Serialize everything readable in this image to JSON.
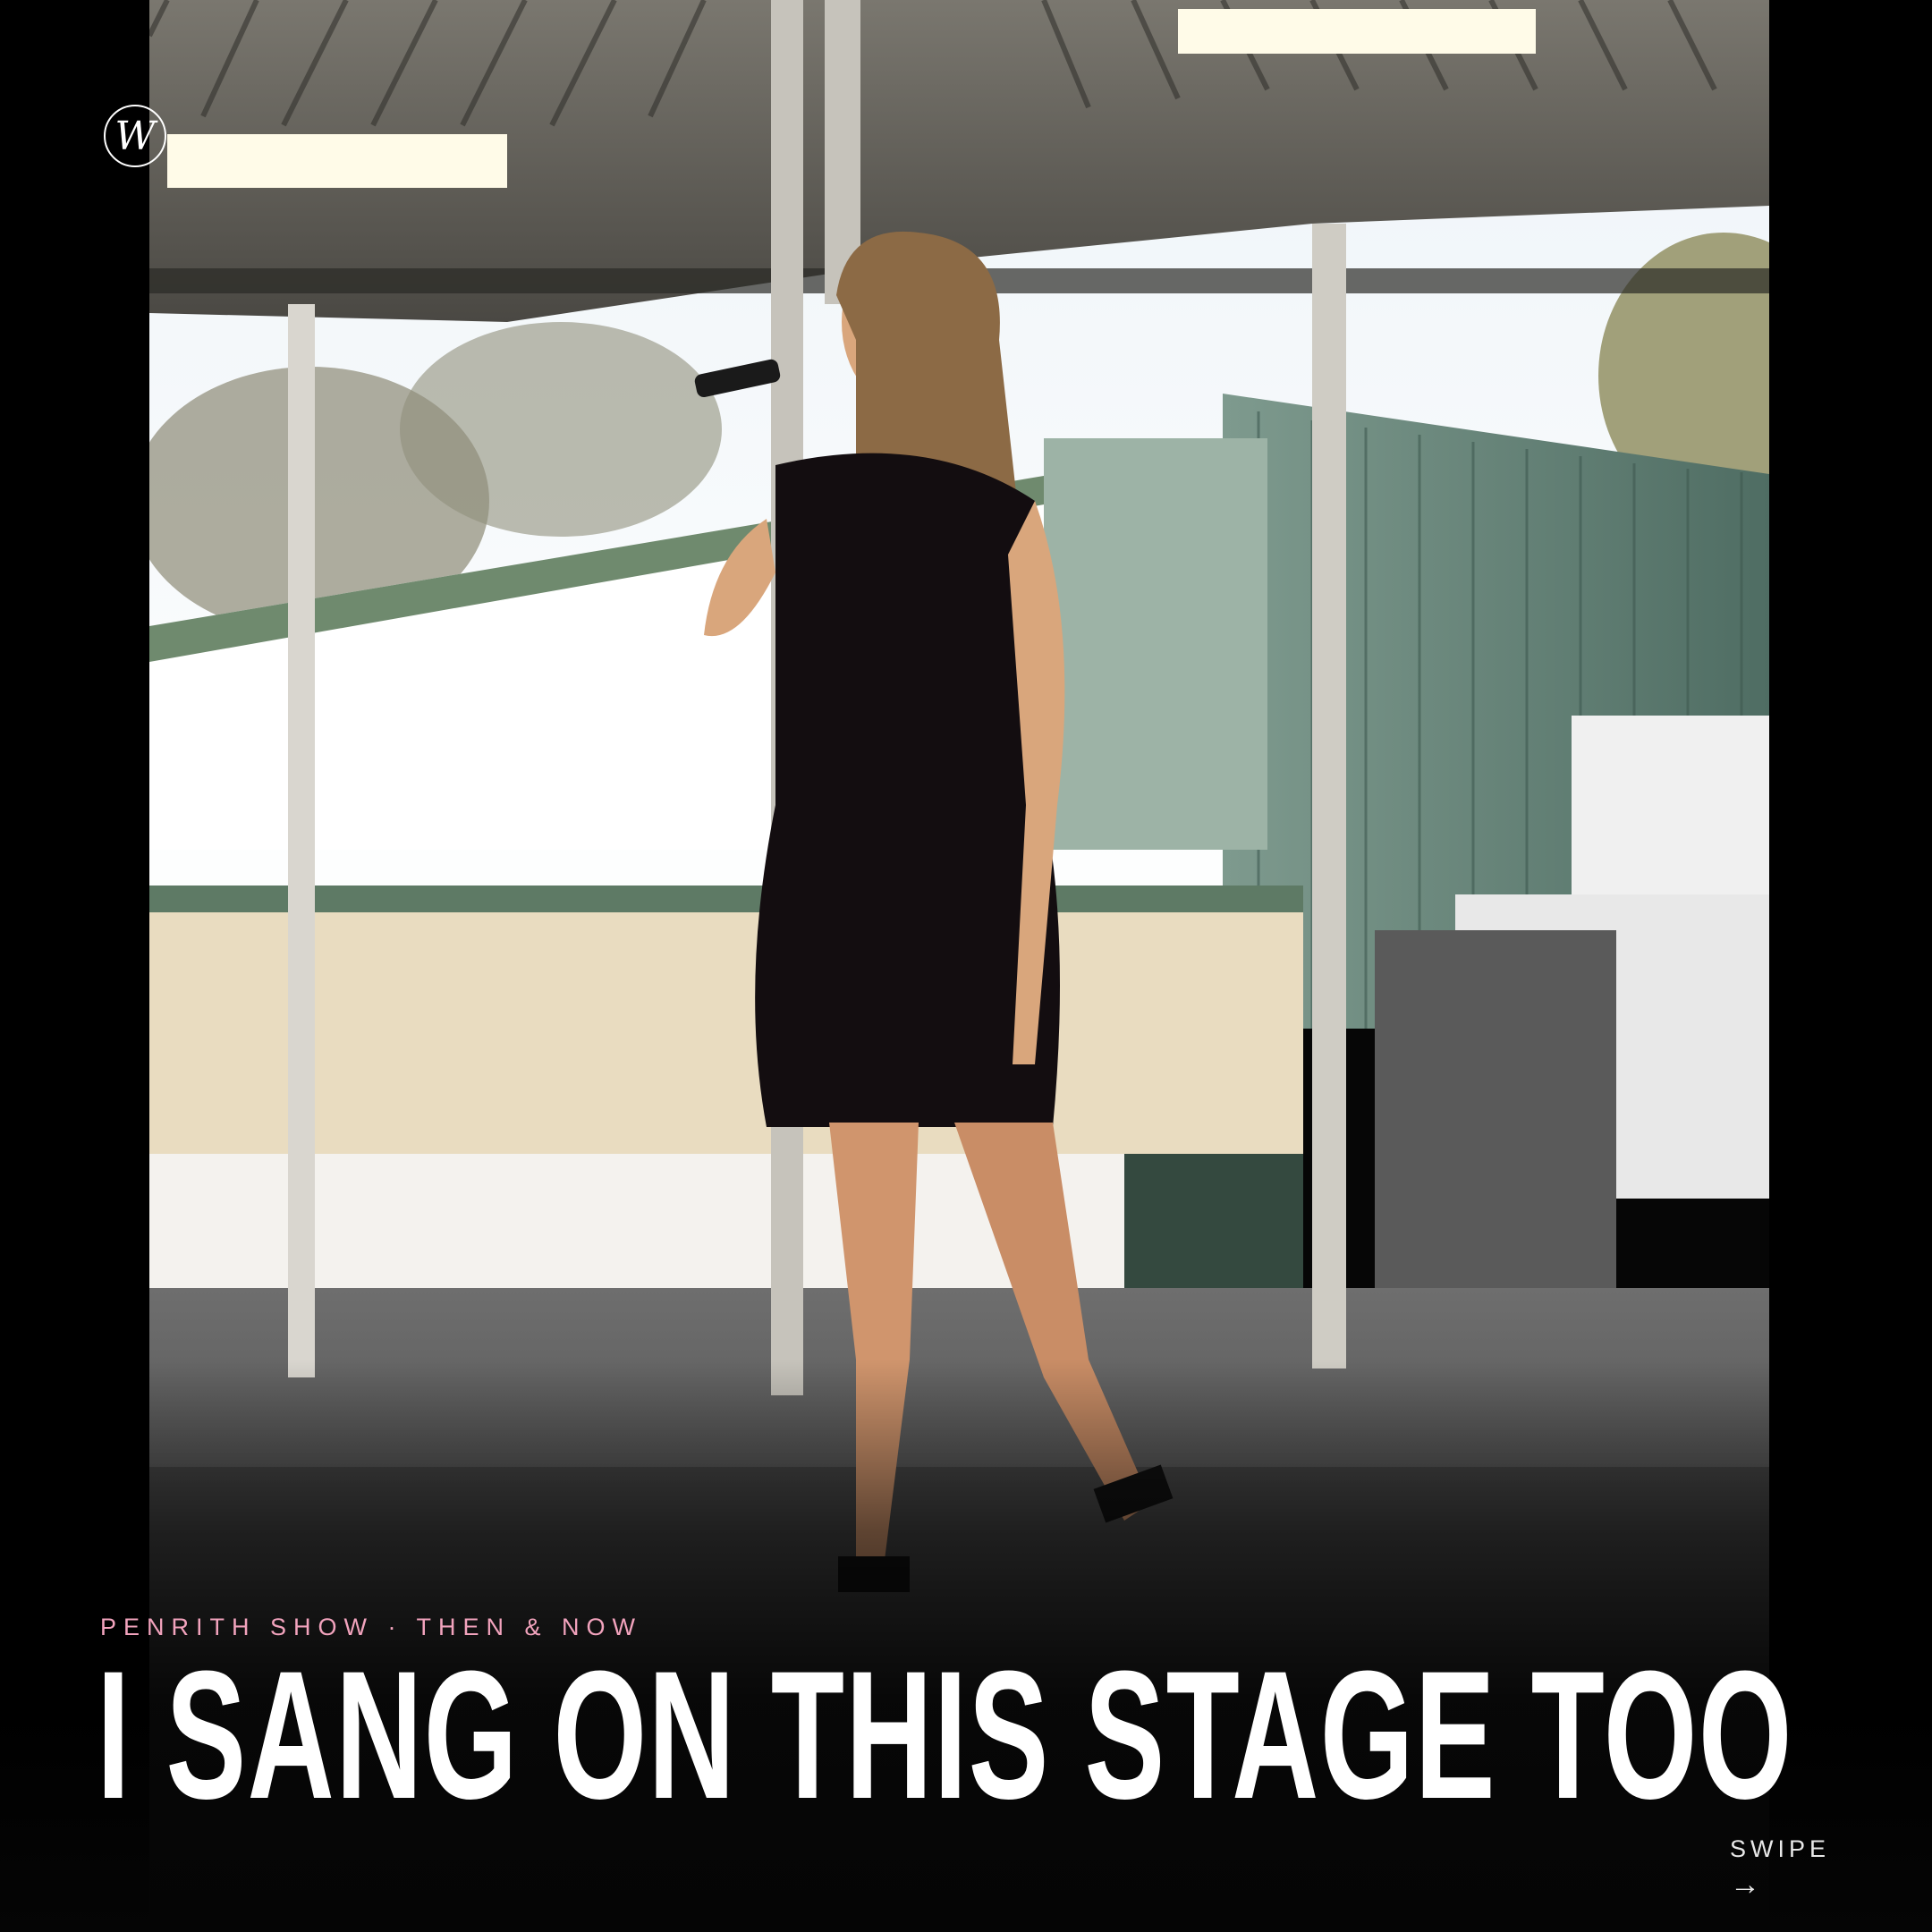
{
  "brand": {
    "logo_letter": "W",
    "logo_icon": "circle-w-monogram"
  },
  "post": {
    "eyebrow": "PENRITH SHOW · THEN & NOW",
    "headline": "I SANG ON THIS STAGE TOO",
    "swipe_label": "SWIPE",
    "swipe_arrow": "→"
  },
  "colors": {
    "background": "#000000",
    "accent_pink": "#f2a3bd",
    "text": "#ffffff"
  }
}
